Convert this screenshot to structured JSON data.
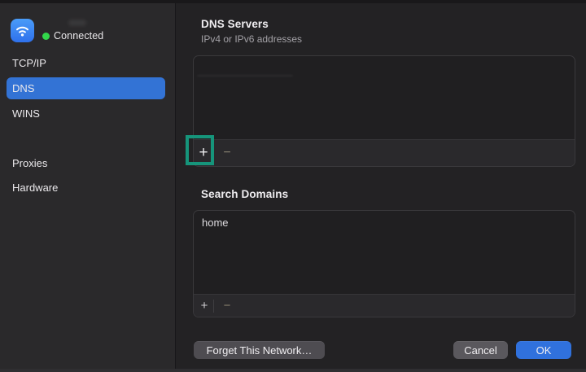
{
  "sidebar": {
    "network": {
      "status_label": "Connected"
    },
    "selected_item": "DNS",
    "items": [
      {
        "label": "TCP/IP"
      },
      {
        "label": "DNS"
      },
      {
        "label": "WINS"
      },
      {
        "label": "Proxies"
      },
      {
        "label": "Hardware"
      }
    ]
  },
  "dns_servers": {
    "title": "DNS Servers",
    "subtitle": "IPv4 or IPv6 addresses",
    "entries": [],
    "add_label": "+",
    "remove_label": "−"
  },
  "search_domains": {
    "title": "Search Domains",
    "entries": [
      "home"
    ],
    "add_label": "+",
    "remove_label": "−"
  },
  "actions": {
    "forget_label": "Forget This Network…",
    "cancel_label": "Cancel",
    "ok_label": "OK"
  },
  "annotation": {
    "target": "dns-add-button",
    "color": "#16957b"
  },
  "colors": {
    "selection_blue": "#3373d5",
    "ok_blue": "#3071dd",
    "connected_green": "#32d74b",
    "annotation_teal": "#16957b",
    "wifi_icon_blue": "#3b86f5"
  },
  "icons": {
    "wifi": "wifi-icon",
    "status_dot": "green-circle",
    "add": "plus-icon",
    "remove": "minus-icon"
  }
}
